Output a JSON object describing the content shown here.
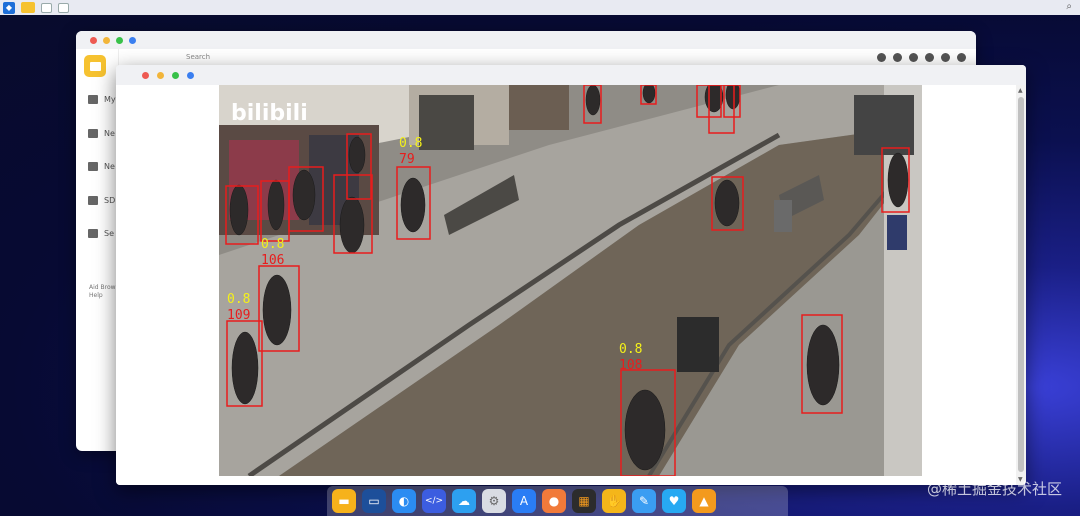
{
  "menubar": {
    "icons": [
      "app-icon",
      "files-icon",
      "window-icon",
      "window-icon"
    ]
  },
  "back_window": {
    "search_placeholder": "Search",
    "sidebar": [
      {
        "label": "My"
      },
      {
        "label": "Ne"
      },
      {
        "label": "Ne"
      },
      {
        "label": "SD"
      },
      {
        "label": "Se"
      }
    ],
    "help_lines": [
      "Aid Brow",
      "Help"
    ]
  },
  "detections": [
    {
      "score": "0.8",
      "id": "79"
    },
    {
      "score": "0.8",
      "id": "106"
    },
    {
      "score": "0.8",
      "id": "109"
    },
    {
      "score": "0.8",
      "id": "108"
    }
  ],
  "dock": {
    "apps": [
      {
        "name": "files",
        "color": "#f6b21b"
      },
      {
        "name": "terminal",
        "color": "#1d4f9a"
      },
      {
        "name": "browser",
        "color": "#2b8cf2"
      },
      {
        "name": "code-editor",
        "color": "#3c5de0"
      },
      {
        "name": "cloud",
        "color": "#2da0f0"
      },
      {
        "name": "settings",
        "color": "#d9dce3"
      },
      {
        "name": "app-store",
        "color": "#2a7df5"
      },
      {
        "name": "tips",
        "color": "#f17a3a"
      },
      {
        "name": "calculator",
        "color": "#2c2c2c"
      },
      {
        "name": "hand-tool",
        "color": "#f4b61a"
      },
      {
        "name": "devtools",
        "color": "#3a9df2"
      },
      {
        "name": "heart-app",
        "color": "#27a9f2"
      },
      {
        "name": "network",
        "color": "#f39a1d"
      }
    ]
  },
  "watermark": "@稀土掘金技术社区"
}
